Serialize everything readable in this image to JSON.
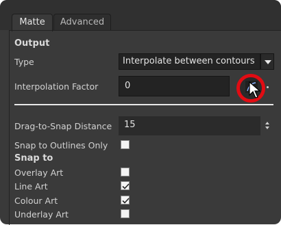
{
  "tabs": {
    "matte": "Matte",
    "advanced": "Advanced"
  },
  "output": {
    "section_title": "Output",
    "type_label": "Type",
    "type_value": "Interpolate between contours",
    "interpolation_label": "Interpolation Factor",
    "interpolation_value": "0"
  },
  "snap": {
    "distance_label": "Drag-to-Snap Distance",
    "distance_value": "15",
    "outlines_only_label": "Snap to Outlines Only",
    "outlines_only_checked": false,
    "snap_to_title": "Snap to",
    "overlay_label": "Overlay Art",
    "overlay_checked": false,
    "line_label": "Line Art",
    "line_checked": true,
    "colour_label": "Colour Art",
    "colour_checked": true,
    "underlay_label": "Underlay Art",
    "underlay_checked": false
  },
  "icons": {
    "dropdown": "chevron-down-icon",
    "function": "function-curve-icon",
    "spinner": "spinner-arrows-icon",
    "cursor": "mouse-pointer-icon"
  },
  "colors": {
    "highlight_ring": "#e10c13",
    "panel_bg": "#3a3a3a"
  }
}
